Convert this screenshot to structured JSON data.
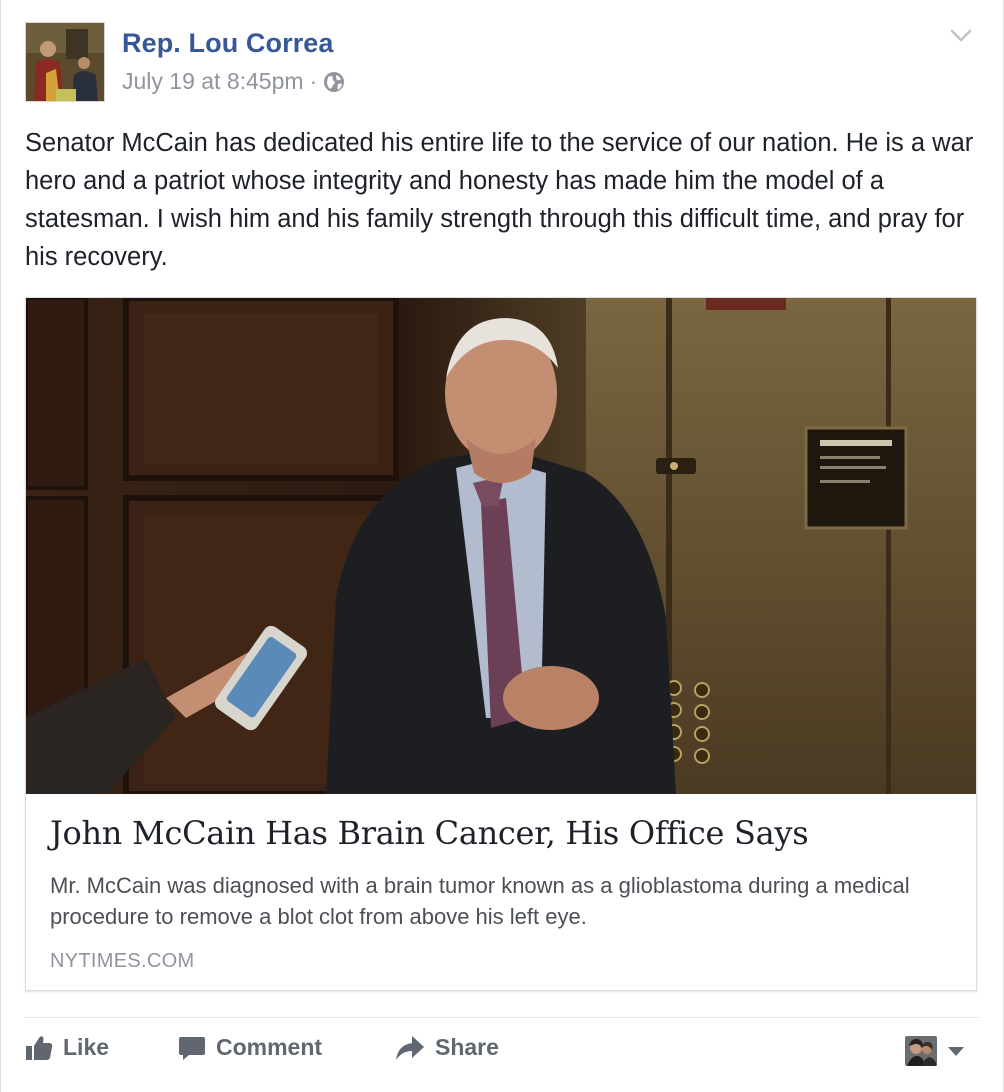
{
  "post": {
    "author": "Rep. Lou Correa",
    "timestamp": "July 19 at 8:45pm",
    "separator": "·",
    "privacy_icon": "globe-icon",
    "menu_icon": "chevron-down-icon",
    "message": "Senator McCain has dedicated his entire life to the service of our nation. He is a war hero and a patriot whose integrity and honesty has made him the model of a statesman. I wish him and his family strength through this difficult time, and pray for his recovery."
  },
  "link": {
    "title": "John McCain Has Brain Cancer, His Office Says",
    "description": "Mr. McCain was diagnosed with a brain tumor known as a glioblastoma during a medical procedure to remove a blot clot from above his left eye.",
    "domain": "NYTIMES.COM",
    "photo_sign_text": "BUILDING EXITS"
  },
  "actions": {
    "like": "Like",
    "comment": "Comment",
    "share": "Share",
    "like_icon": "thumbs-up-icon",
    "comment_icon": "speech-bubble-icon",
    "share_icon": "share-arrow-icon",
    "audience_icon": "chevron-down-icon"
  },
  "colors": {
    "author_link": "#365899",
    "meta_text": "#90949c",
    "body_text": "#1d2129",
    "action_text": "#606770",
    "border": "#dddfe2"
  }
}
